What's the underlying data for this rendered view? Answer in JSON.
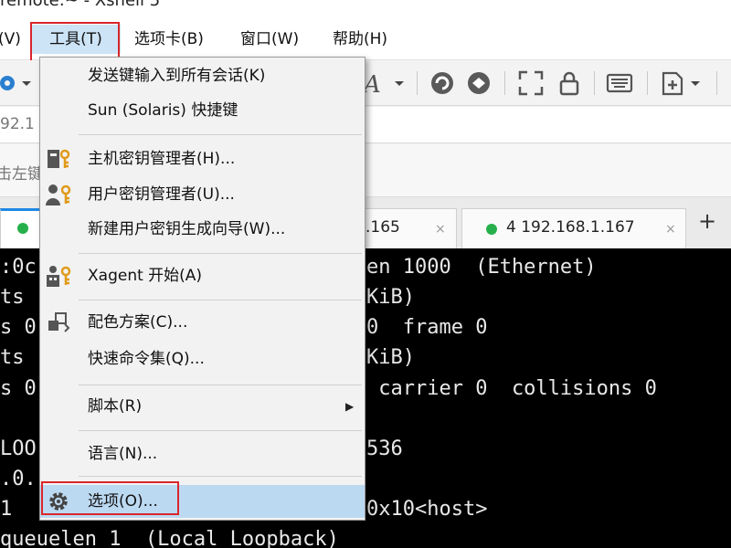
{
  "window": {
    "title": "remote:~ - Xshell 5"
  },
  "menubar": {
    "items": [
      {
        "label": "(V)"
      },
      {
        "label": "工具(T)"
      },
      {
        "label": "选项卡(B)"
      },
      {
        "label": "窗口(W)"
      },
      {
        "label": "帮助(H)"
      }
    ]
  },
  "address": {
    "text": "92.1"
  },
  "hint": {
    "text": "击左键"
  },
  "tabs": [
    {
      "label": ".165",
      "close": "×"
    },
    {
      "label": "4 192.168.1.167",
      "close": "×"
    }
  ],
  "tab_add": "+",
  "terminal": {
    "lines": [
      {
        "left": ":0c",
        "right": "en 1000  (Ethernet)"
      },
      {
        "left": "ts",
        "right": "KiB)"
      },
      {
        "left": "s 0",
        "right": "0  frame 0"
      },
      {
        "left": "ts",
        "right": "KiB)"
      },
      {
        "left": "s 0",
        "right": " carrier 0  collisions 0"
      },
      {
        "left": "",
        "right": ""
      },
      {
        "left": "LOO",
        "right": "536"
      },
      {
        "left": ".0.",
        "right": ""
      },
      {
        "left": "1",
        "right": "0x10<host>"
      },
      {
        "left": "queuelen 1  (Local Loopback)",
        "right": ""
      }
    ]
  },
  "tools_menu": {
    "items": [
      {
        "label": "发送键输入到所有会话(K)",
        "icon": ""
      },
      {
        "label": "Sun (Solaris) 快捷键",
        "icon": ""
      },
      {
        "label": "主机密钥管理者(H)...",
        "icon": "host-key-icon"
      },
      {
        "label": "用户密钥管理者(U)...",
        "icon": "user-key-icon"
      },
      {
        "label": "新建用户密钥生成向导(W)...",
        "icon": ""
      },
      {
        "label": "Xagent 开始(A)",
        "icon": "xagent-icon"
      },
      {
        "label": "配色方案(C)...",
        "icon": "color-scheme-icon"
      },
      {
        "label": "快速命令集(Q)...",
        "icon": ""
      },
      {
        "label": "脚本(R)",
        "icon": "",
        "submenu_arrow": "▶"
      },
      {
        "label": "语言(N)...",
        "icon": ""
      },
      {
        "label": "选项(O)...",
        "icon": "gear-icon"
      }
    ]
  },
  "colors": {
    "menu_highlight": "#cde4f7",
    "option_highlight": "#bcd9f2",
    "annotation_red": "#d9262b",
    "tab_dot_green": "#26b04b",
    "terminal_bg": "#000000"
  }
}
